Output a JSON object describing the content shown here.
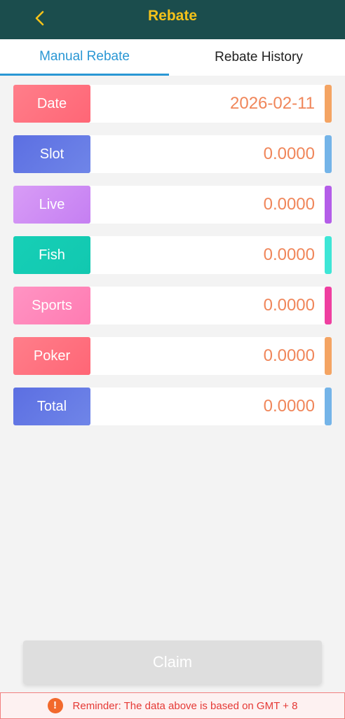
{
  "header": {
    "title": "Rebate"
  },
  "tabs": [
    {
      "label": "Manual Rebate",
      "active": true
    },
    {
      "label": "Rebate History",
      "active": false
    }
  ],
  "rows": [
    {
      "label": "Date",
      "value": "2026-02-11",
      "label_color_from": "#ff7e8a",
      "label_color_to": "#ff6676",
      "accent": "#f4a463"
    },
    {
      "label": "Slot",
      "value": "0.0000",
      "label_color_from": "#5c6fe2",
      "label_color_to": "#6f85e8",
      "accent": "#74b4e8"
    },
    {
      "label": "Live",
      "value": "0.0000",
      "label_color_from": "#d89cf6",
      "label_color_to": "#c57ff2",
      "accent": "#b45de8"
    },
    {
      "label": "Fish",
      "value": "0.0000",
      "label_color_from": "#16cfb6",
      "label_color_to": "#12c8b0",
      "accent": "#3ee6d6"
    },
    {
      "label": "Sports",
      "value": "0.0000",
      "label_color_from": "#ff94c3",
      "label_color_to": "#ff7bb2",
      "accent": "#ef3fa0"
    },
    {
      "label": "Poker",
      "value": "0.0000",
      "label_color_from": "#ff7e8a",
      "label_color_to": "#ff6676",
      "accent": "#f4a463"
    },
    {
      "label": "Total",
      "value": "0.0000",
      "label_color_from": "#5c6fe2",
      "label_color_to": "#6f85e8",
      "accent": "#74b4e8"
    }
  ],
  "claim_label": "Claim",
  "reminder": {
    "icon": "!",
    "text": "Reminder: The data above is based on GMT + 8"
  },
  "colors": {
    "header_bg": "#1b4d4d",
    "title": "#f4c21a",
    "tab_active": "#2a97d4",
    "value_text": "#f0865a",
    "reminder_text": "#e53935"
  }
}
